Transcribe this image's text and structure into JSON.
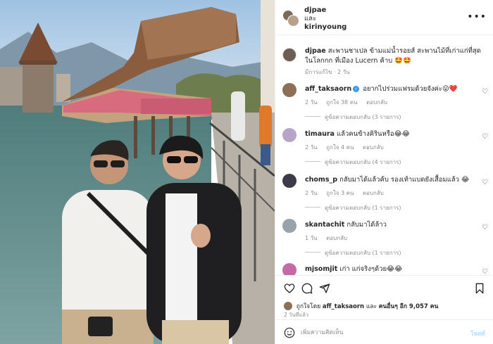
{
  "header": {
    "user1": "djpae",
    "and": "และ",
    "user2": "kirinyoung",
    "more": "•••"
  },
  "caption": {
    "username": "djpae",
    "text": "สะพานชาเปล ข้ามแม่น้ำรอยส์ สะพานไม้ที่เก่าแก่ที่สุดในโลกกก ที่เมือง Lucern ค้าบ 🤩🤩",
    "meta": "มีการแก้ไข · 2 วัน"
  },
  "comments": [
    {
      "username": "aff_taksaorn",
      "verified": true,
      "text": "อยากไปร่วมแฟรมด้วยจังค่ะ😜❤️",
      "time": "2 วัน",
      "likes": "ถูกใจ 38 คน",
      "reply": "ตอบกลับ",
      "view_replies": "ดูข้อความตอบกลับ (3 รายการ)",
      "avatar_color": "#8d6e57"
    },
    {
      "username": "timaura",
      "verified": false,
      "text": "แล้วคนข้างคิรินหรือ😂😂",
      "time": "2 วัน",
      "likes": "ถูกใจ 4 คน",
      "reply": "ตอบกลับ",
      "view_replies": "ดูข้อความตอบกลับ (4 รายการ)",
      "avatar_color": "#b7a4c9"
    },
    {
      "username": "choms_p",
      "verified": false,
      "text": "กลับมาได้แล้วค้บ รองเท้าแบดยังเสื้อมแล้ว 😂",
      "time": "2 วัน",
      "likes": "ถูกใจ 3 คน",
      "reply": "ตอบกลับ",
      "view_replies": "ดูข้อความตอบกลับ (1 รายการ)",
      "avatar_color": "#3d3a4a"
    },
    {
      "username": "skantachit",
      "verified": false,
      "text": "กลับมาได้ล้าว",
      "time": "1 วัน",
      "likes": "",
      "reply": "ตอบกลับ",
      "view_replies": "ดูข้อความตอบกลับ (1 รายการ)",
      "avatar_color": "#9aa3ab"
    },
    {
      "username": "mjsomjit",
      "verified": false,
      "text": "เก่า แก่จริงๆด้วย😂😂",
      "time": "",
      "likes": "",
      "reply": "",
      "view_replies": "",
      "avatar_color": "#c46aa8"
    }
  ],
  "actions": {
    "icons": [
      "heart-icon",
      "comment-icon",
      "share-icon",
      "bookmark-icon"
    ],
    "likes_prefix": "ถูกใจโดย",
    "likes_user": "aff_taksaorn",
    "likes_middle": "และ",
    "likes_others": "คนอื่นๆ อีก 9,057 คน",
    "ago": "2 วันที่แล้ว"
  },
  "add_comment": {
    "placeholder": "เพิ่มความคิดเห็น",
    "post_label": "โพสต์"
  },
  "colors": {
    "accent": "#0095f6",
    "post_disabled": "#b2dffc",
    "verified": "#3897f0",
    "heart_red": "#ed4956"
  }
}
